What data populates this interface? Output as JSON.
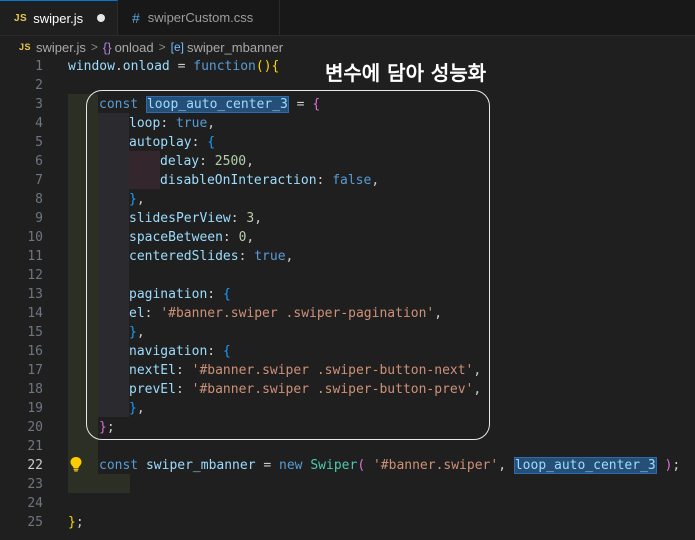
{
  "tabs": [
    {
      "badge": "JS",
      "label": "swiper.js",
      "active": true
    },
    {
      "badge": "#",
      "label": "swiperCustom.css",
      "active": false
    }
  ],
  "breadcrumb": {
    "file_badge": "JS",
    "file": "swiper.js",
    "sep": ">",
    "symbol_icon": "{}",
    "symbol": "onload",
    "var_icon": "[e]",
    "variable": "swiper_mbanner"
  },
  "annotation": "변수에 담아 성능화",
  "lines": [
    "1",
    "2",
    "3",
    "4",
    "5",
    "6",
    "7",
    "8",
    "9",
    "10",
    "11",
    "12",
    "13",
    "14",
    "15",
    "16",
    "17",
    "18",
    "19",
    "20",
    "21",
    "22",
    "23",
    "24",
    "25"
  ],
  "code": {
    "l1": {
      "obj": "window",
      "dot": ".",
      "prop": "onload",
      "eq": " = ",
      "kw": "function",
      "paren": "()",
      "brace": "{"
    },
    "l3": {
      "kw": "const",
      "name": "loop_auto_center_3",
      "eq": " = ",
      "brace": "{"
    },
    "l4": {
      "key": "loop",
      "colon": ": ",
      "val": "true",
      "comma": ","
    },
    "l5": {
      "key": "autoplay",
      "colon": ": ",
      "brace": "{"
    },
    "l6": {
      "key": "delay",
      "colon": ": ",
      "val": "2500",
      "comma": ","
    },
    "l7": {
      "key": "disableOnInteraction",
      "colon": ": ",
      "val": "false",
      "comma": ","
    },
    "l8": {
      "brace": "}",
      "comma": ","
    },
    "l9": {
      "key": "slidesPerView",
      "colon": ": ",
      "val": "3",
      "comma": ","
    },
    "l10": {
      "key": "spaceBetween",
      "colon": ": ",
      "val": "0",
      "comma": ","
    },
    "l11": {
      "key": "centeredSlides",
      "colon": ": ",
      "val": "true",
      "comma": ","
    },
    "l13": {
      "key": "pagination",
      "colon": ": ",
      "brace": "{"
    },
    "l14": {
      "key": "el",
      "colon": ": ",
      "val": "'#banner.swiper .swiper-pagination'",
      "comma": ","
    },
    "l15": {
      "brace": "}",
      "comma": ","
    },
    "l16": {
      "key": "navigation",
      "colon": ": ",
      "brace": "{"
    },
    "l17": {
      "key": "nextEl",
      "colon": ": ",
      "val": "'#banner.swiper .swiper-button-next'",
      "comma": ","
    },
    "l18": {
      "key": "prevEl",
      "colon": ": ",
      "val": "'#banner.swiper .swiper-button-prev'",
      "comma": ","
    },
    "l19": {
      "brace": "}",
      "comma": ","
    },
    "l20": {
      "brace": "}",
      "semi": ";"
    },
    "l22": {
      "kw": "const",
      "name": "swiper_mbanner",
      "eq": " = ",
      "kw2": "new",
      "cls": "Swiper",
      "open": "(",
      "str": "'#banner.swiper'",
      "comma": ", ",
      "arg": "loop_auto_center_3",
      "close": ")",
      "semi": ";"
    },
    "l25": {
      "brace": "}",
      "semi": ";"
    }
  }
}
